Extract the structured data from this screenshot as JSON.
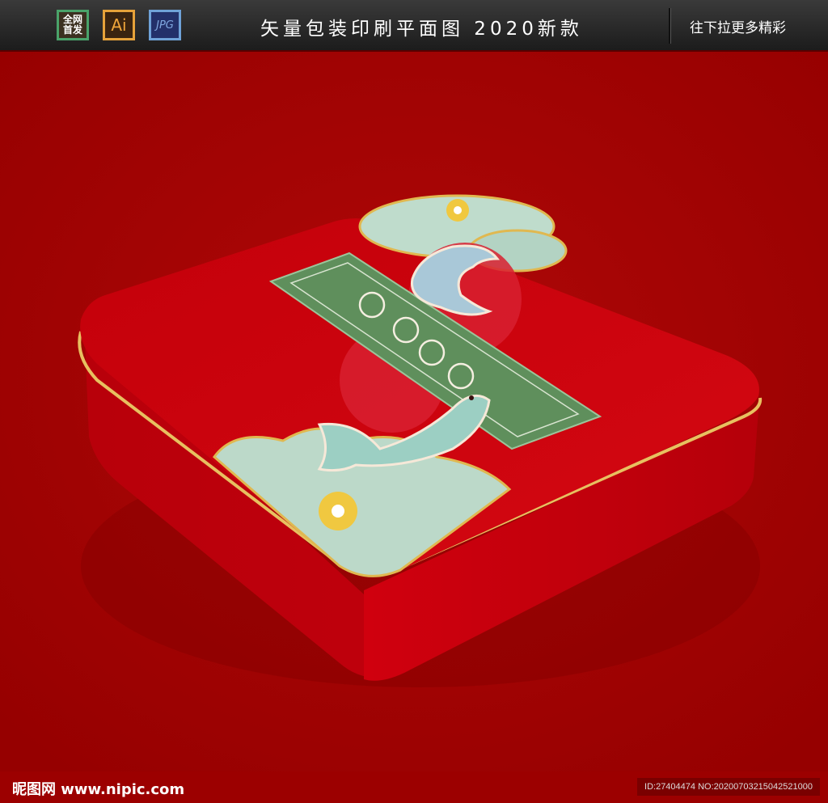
{
  "header": {
    "badges": [
      {
        "label": "全网\n首发",
        "color": "#4aa36a"
      },
      {
        "label": "Ai",
        "color": "#e6a23a"
      },
      {
        "label": "JPG",
        "color": "#6fa2d8"
      }
    ],
    "title": "矢量包装印刷平面图 2020新款",
    "more_link": "往下拉更多精彩"
  },
  "footer": {
    "site_logo": "昵图网 www.nipic.com",
    "image_id": "ID:27404474 NO:20200703215042521000"
  },
  "colors": {
    "background": "#9c0000",
    "box_red": "#c8000a",
    "label_green": "#5f8f5c",
    "gold_rim": "#e8c060"
  }
}
